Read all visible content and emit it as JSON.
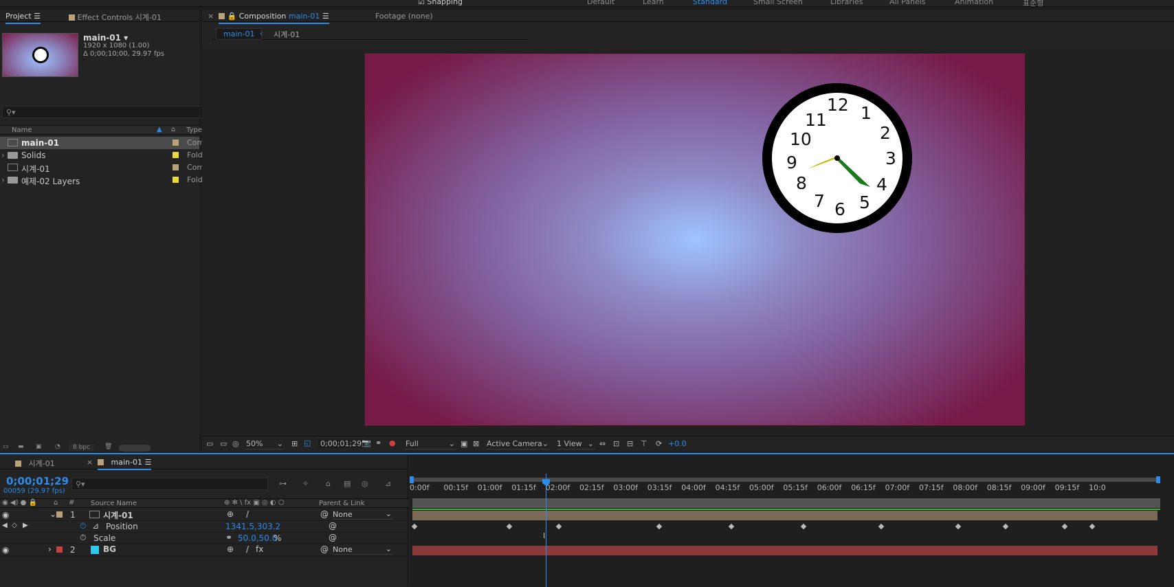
{
  "topbar": {
    "snapping": "Snapping",
    "workspaces": [
      "Default",
      "Learn",
      "Standard",
      "Small Screen",
      "Libraries",
      "All Panels",
      "Animation",
      "표준형"
    ],
    "active_workspace": "Standard"
  },
  "project": {
    "tab_project": "Project",
    "tab_effect_controls": "Effect Controls 시계-01",
    "selected_name": "main-01",
    "selected_info1": "1920 x 1080 (1.00)",
    "selected_info2": "Δ 0;00;10;00, 29.97 fps",
    "col_name": "Name",
    "col_type": "Type",
    "items": [
      {
        "name": "main-01",
        "type": "Com",
        "color": "#b9a27a",
        "kind": "comp",
        "selected": true
      },
      {
        "name": "Solids",
        "type": "Fold",
        "color": "#e8d83a",
        "kind": "folder",
        "selected": false
      },
      {
        "name": "시계-01",
        "type": "Com",
        "color": "#b9a27a",
        "kind": "comp",
        "selected": false
      },
      {
        "name": "예제-02 Layers",
        "type": "Fold",
        "color": "#e8d83a",
        "kind": "folder",
        "selected": false
      }
    ],
    "bpc": "8 bpc"
  },
  "composition": {
    "tab_label": "Composition",
    "tab_comp_name": "main-01",
    "tab_footage": "Footage (none)",
    "breadcrumb_1": "main-01",
    "breadcrumb_2": "시계-01",
    "zoom": "50%",
    "timecode": "0;00;01;29",
    "resolution": "Full",
    "camera": "Active Camera",
    "views": "1 View",
    "exposure": "+0.0"
  },
  "clock": {
    "numbers": [
      "12",
      "1",
      "2",
      "3",
      "4",
      "5",
      "6",
      "7",
      "8",
      "9",
      "10",
      "11"
    ]
  },
  "timeline": {
    "tab1": "시계-01",
    "tab2": "main-01",
    "timecode": "0;00;01;29",
    "fps": "00059 (29.97 fps)",
    "col_source": "Source Name",
    "col_parent": "Parent & Link",
    "layers": [
      {
        "num": "1",
        "name": "시계-01",
        "color": "#b9a27a",
        "parent": "None"
      },
      {
        "num": "2",
        "name": "BG",
        "color": "#c94040",
        "parent": "None"
      }
    ],
    "position_label": "Position",
    "position_value": "1341.5,303.2",
    "scale_label": "Scale",
    "scale_value": "50.0,50.0",
    "scale_unit": "%",
    "ruler": [
      "0:00f",
      "00:15f",
      "01:00f",
      "01:15f",
      "02:00f",
      "02:15f",
      "03:00f",
      "03:15f",
      "04:00f",
      "04:15f",
      "05:00f",
      "05:15f",
      "06:00f",
      "06:15f",
      "07:00f",
      "07:15f",
      "08:00f",
      "08:15f",
      "09:00f",
      "09:15f",
      "10:0"
    ]
  }
}
